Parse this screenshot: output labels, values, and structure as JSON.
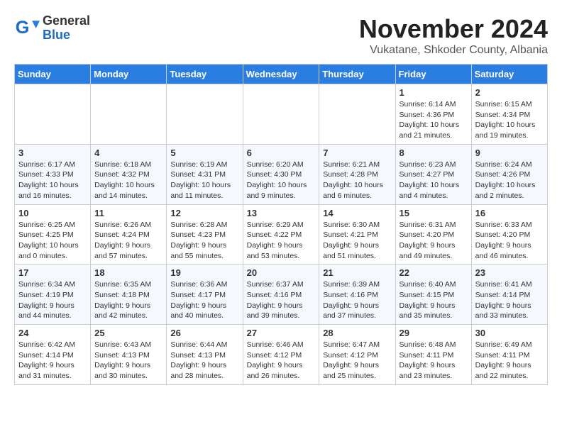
{
  "logo": {
    "general": "General",
    "blue": "Blue"
  },
  "header": {
    "month": "November 2024",
    "location": "Vukatane, Shkoder County, Albania"
  },
  "weekdays": [
    "Sunday",
    "Monday",
    "Tuesday",
    "Wednesday",
    "Thursday",
    "Friday",
    "Saturday"
  ],
  "weeks": [
    [
      {
        "day": "",
        "info": ""
      },
      {
        "day": "",
        "info": ""
      },
      {
        "day": "",
        "info": ""
      },
      {
        "day": "",
        "info": ""
      },
      {
        "day": "",
        "info": ""
      },
      {
        "day": "1",
        "info": "Sunrise: 6:14 AM\nSunset: 4:36 PM\nDaylight: 10 hours\nand 21 minutes."
      },
      {
        "day": "2",
        "info": "Sunrise: 6:15 AM\nSunset: 4:34 PM\nDaylight: 10 hours\nand 19 minutes."
      }
    ],
    [
      {
        "day": "3",
        "info": "Sunrise: 6:17 AM\nSunset: 4:33 PM\nDaylight: 10 hours\nand 16 minutes."
      },
      {
        "day": "4",
        "info": "Sunrise: 6:18 AM\nSunset: 4:32 PM\nDaylight: 10 hours\nand 14 minutes."
      },
      {
        "day": "5",
        "info": "Sunrise: 6:19 AM\nSunset: 4:31 PM\nDaylight: 10 hours\nand 11 minutes."
      },
      {
        "day": "6",
        "info": "Sunrise: 6:20 AM\nSunset: 4:30 PM\nDaylight: 10 hours\nand 9 minutes."
      },
      {
        "day": "7",
        "info": "Sunrise: 6:21 AM\nSunset: 4:28 PM\nDaylight: 10 hours\nand 6 minutes."
      },
      {
        "day": "8",
        "info": "Sunrise: 6:23 AM\nSunset: 4:27 PM\nDaylight: 10 hours\nand 4 minutes."
      },
      {
        "day": "9",
        "info": "Sunrise: 6:24 AM\nSunset: 4:26 PM\nDaylight: 10 hours\nand 2 minutes."
      }
    ],
    [
      {
        "day": "10",
        "info": "Sunrise: 6:25 AM\nSunset: 4:25 PM\nDaylight: 10 hours\nand 0 minutes."
      },
      {
        "day": "11",
        "info": "Sunrise: 6:26 AM\nSunset: 4:24 PM\nDaylight: 9 hours\nand 57 minutes."
      },
      {
        "day": "12",
        "info": "Sunrise: 6:28 AM\nSunset: 4:23 PM\nDaylight: 9 hours\nand 55 minutes."
      },
      {
        "day": "13",
        "info": "Sunrise: 6:29 AM\nSunset: 4:22 PM\nDaylight: 9 hours\nand 53 minutes."
      },
      {
        "day": "14",
        "info": "Sunrise: 6:30 AM\nSunset: 4:21 PM\nDaylight: 9 hours\nand 51 minutes."
      },
      {
        "day": "15",
        "info": "Sunrise: 6:31 AM\nSunset: 4:20 PM\nDaylight: 9 hours\nand 49 minutes."
      },
      {
        "day": "16",
        "info": "Sunrise: 6:33 AM\nSunset: 4:20 PM\nDaylight: 9 hours\nand 46 minutes."
      }
    ],
    [
      {
        "day": "17",
        "info": "Sunrise: 6:34 AM\nSunset: 4:19 PM\nDaylight: 9 hours\nand 44 minutes."
      },
      {
        "day": "18",
        "info": "Sunrise: 6:35 AM\nSunset: 4:18 PM\nDaylight: 9 hours\nand 42 minutes."
      },
      {
        "day": "19",
        "info": "Sunrise: 6:36 AM\nSunset: 4:17 PM\nDaylight: 9 hours\nand 40 minutes."
      },
      {
        "day": "20",
        "info": "Sunrise: 6:37 AM\nSunset: 4:16 PM\nDaylight: 9 hours\nand 39 minutes."
      },
      {
        "day": "21",
        "info": "Sunrise: 6:39 AM\nSunset: 4:16 PM\nDaylight: 9 hours\nand 37 minutes."
      },
      {
        "day": "22",
        "info": "Sunrise: 6:40 AM\nSunset: 4:15 PM\nDaylight: 9 hours\nand 35 minutes."
      },
      {
        "day": "23",
        "info": "Sunrise: 6:41 AM\nSunset: 4:14 PM\nDaylight: 9 hours\nand 33 minutes."
      }
    ],
    [
      {
        "day": "24",
        "info": "Sunrise: 6:42 AM\nSunset: 4:14 PM\nDaylight: 9 hours\nand 31 minutes."
      },
      {
        "day": "25",
        "info": "Sunrise: 6:43 AM\nSunset: 4:13 PM\nDaylight: 9 hours\nand 30 minutes."
      },
      {
        "day": "26",
        "info": "Sunrise: 6:44 AM\nSunset: 4:13 PM\nDaylight: 9 hours\nand 28 minutes."
      },
      {
        "day": "27",
        "info": "Sunrise: 6:46 AM\nSunset: 4:12 PM\nDaylight: 9 hours\nand 26 minutes."
      },
      {
        "day": "28",
        "info": "Sunrise: 6:47 AM\nSunset: 4:12 PM\nDaylight: 9 hours\nand 25 minutes."
      },
      {
        "day": "29",
        "info": "Sunrise: 6:48 AM\nSunset: 4:11 PM\nDaylight: 9 hours\nand 23 minutes."
      },
      {
        "day": "30",
        "info": "Sunrise: 6:49 AM\nSunset: 4:11 PM\nDaylight: 9 hours\nand 22 minutes."
      }
    ]
  ]
}
